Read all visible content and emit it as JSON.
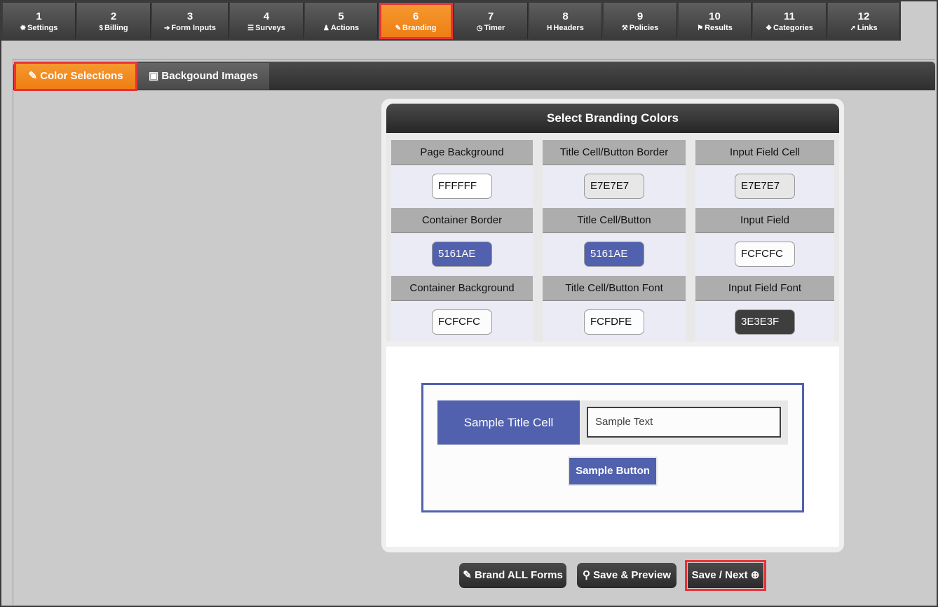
{
  "steps": [
    {
      "num": "1",
      "label": "Settings",
      "icon": "gear-icon",
      "glyph": "✹"
    },
    {
      "num": "2",
      "label": "Billing",
      "icon": "dollar-icon",
      "glyph": "$"
    },
    {
      "num": "3",
      "label": "Form Inputs",
      "icon": "sign-in-icon",
      "glyph": "➔"
    },
    {
      "num": "4",
      "label": "Surveys",
      "icon": "list-icon",
      "glyph": "☰"
    },
    {
      "num": "5",
      "label": "Actions",
      "icon": "user-icon",
      "glyph": "♟"
    },
    {
      "num": "6",
      "label": "Branding",
      "icon": "brush-icon",
      "glyph": "✎"
    },
    {
      "num": "7",
      "label": "Timer",
      "icon": "clock-icon",
      "glyph": "◷"
    },
    {
      "num": "8",
      "label": "Headers",
      "icon": "header-icon",
      "glyph": "H"
    },
    {
      "num": "9",
      "label": "Policies",
      "icon": "gavel-icon",
      "glyph": "⚒"
    },
    {
      "num": "10",
      "label": "Results",
      "icon": "flag-icon",
      "glyph": "⚑"
    },
    {
      "num": "11",
      "label": "Categories",
      "icon": "cubes-icon",
      "glyph": "❖"
    },
    {
      "num": "12",
      "label": "Links",
      "icon": "pointer-icon",
      "glyph": "➚"
    }
  ],
  "subtabs": {
    "colors_label": "Color Selections",
    "colors_icon": "brush-icon",
    "images_label": "Backgound Images",
    "images_icon": "image-icon"
  },
  "panel": {
    "title": "Select Branding Colors",
    "cells": [
      {
        "label": "Page Background",
        "value": "FFFFFF",
        "bg": "#FFFFFF",
        "fg": "#111111"
      },
      {
        "label": "Title Cell/Button Border",
        "value": "E7E7E7",
        "bg": "#E7E7E7",
        "fg": "#111111"
      },
      {
        "label": "Input Field Cell",
        "value": "E7E7E7",
        "bg": "#E7E7E7",
        "fg": "#111111"
      },
      {
        "label": "Container Border",
        "value": "5161AE",
        "bg": "#5161AE",
        "fg": "#FFFFFF"
      },
      {
        "label": "Title Cell/Button",
        "value": "5161AE",
        "bg": "#5161AE",
        "fg": "#FFFFFF"
      },
      {
        "label": "Input Field",
        "value": "FCFCFC",
        "bg": "#FCFCFC",
        "fg": "#111111"
      },
      {
        "label": "Container Background",
        "value": "FCFCFC",
        "bg": "#FCFCFC",
        "fg": "#111111"
      },
      {
        "label": "Title Cell/Button Font",
        "value": "FCFDFE",
        "bg": "#FCFDFE",
        "fg": "#111111"
      },
      {
        "label": "Input Field Font",
        "value": "3E3E3F",
        "bg": "#3E3E3F",
        "fg": "#FFFFFF"
      }
    ]
  },
  "sample": {
    "title_cell": "Sample Title Cell",
    "input_text": "Sample Text",
    "button": "Sample Button"
  },
  "buttons": {
    "brand_all": "Brand ALL Forms",
    "save_preview": "Save & Preview",
    "save_next": "Save / Next"
  },
  "colors": {
    "accent": "#EE7D12",
    "highlight": "#E8323A"
  }
}
